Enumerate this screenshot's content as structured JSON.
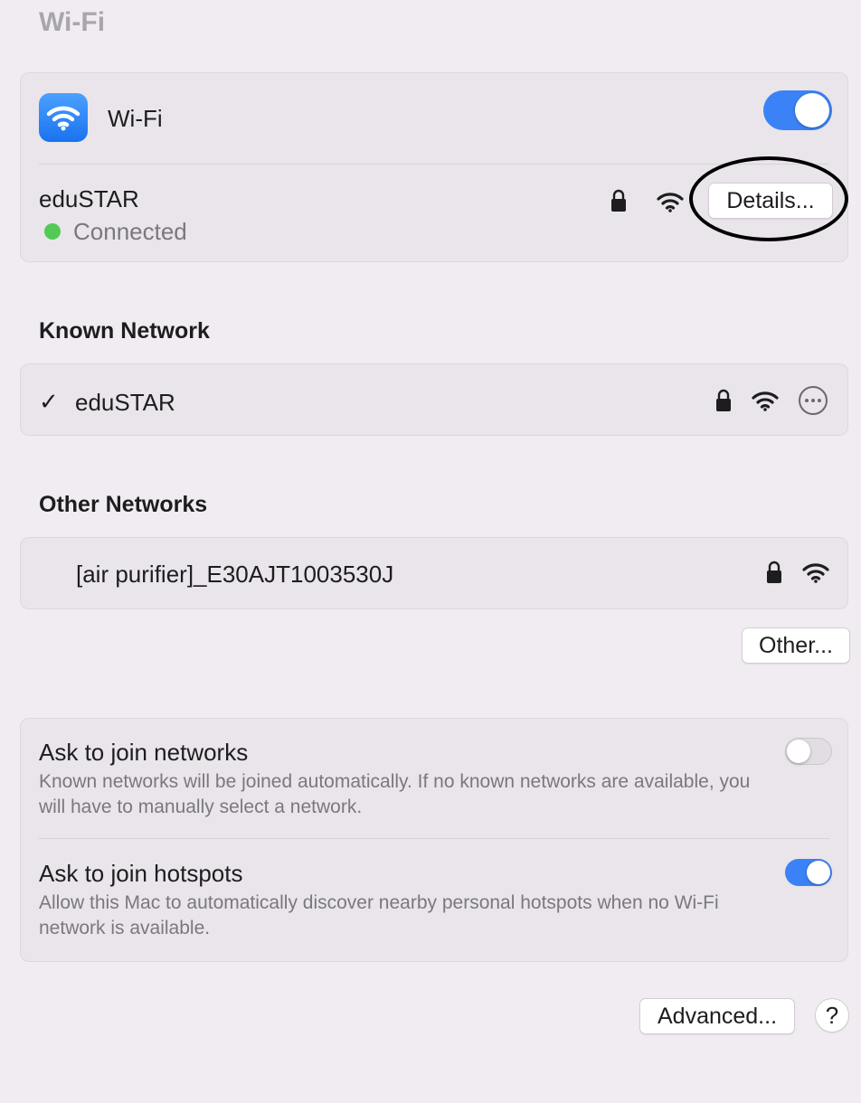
{
  "page": {
    "title": "Wi-Fi"
  },
  "wifi": {
    "label": "Wi-Fi",
    "enabled": true,
    "current_network": {
      "name": "eduSTAR",
      "status": "Connected",
      "status_color": "#54c958",
      "details_button": "Details..."
    }
  },
  "known_networks": {
    "header": "Known Network",
    "items": [
      {
        "checkmark": "✓",
        "name": "eduSTAR",
        "secured": true
      }
    ]
  },
  "other_networks": {
    "header": "Other Networks",
    "items": [
      {
        "name": "[air purifier]_E30AJT1003530J",
        "secured": true
      }
    ],
    "other_button": "Other..."
  },
  "preferences": {
    "ask_to_join_networks": {
      "title": "Ask to join networks",
      "description": "Known networks will be joined automatically. If no known networks are available, you will have to manually select a network.",
      "enabled": false
    },
    "ask_to_join_hotspots": {
      "title": "Ask to join hotspots",
      "description": "Allow this Mac to automatically discover nearby personal hotspots when no Wi-Fi network is available.",
      "enabled": true
    }
  },
  "footer": {
    "advanced_button": "Advanced...",
    "help_button": "?"
  },
  "colors": {
    "accent": "#3b82f6",
    "background": "#f1ecf1",
    "card": "#e9e5ea"
  },
  "icons": [
    "wifi-icon",
    "lock-icon",
    "more-icon",
    "checkmark-icon",
    "help-icon"
  ]
}
